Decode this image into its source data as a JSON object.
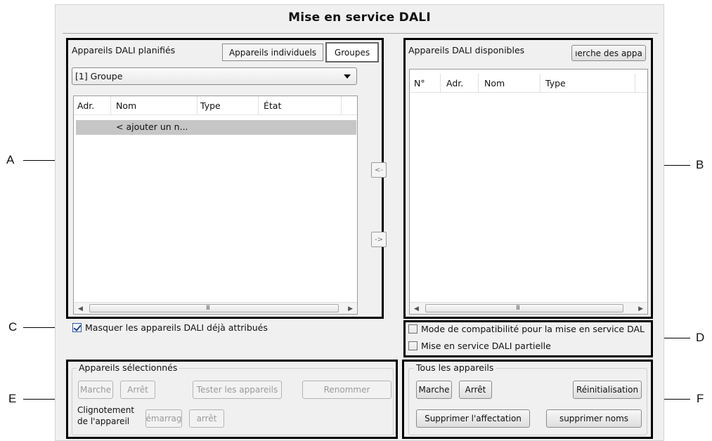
{
  "dialog": {
    "title": "Mise en service DALI"
  },
  "callouts": {
    "a": "A",
    "b": "B",
    "c": "C",
    "d": "D",
    "e": "E",
    "f": "F"
  },
  "planned": {
    "label": "Appareils DALI planifiés",
    "tab_individual": "Appareils individuels",
    "tab_groups": "Groupes",
    "dropdown_value": "[1] Groupe",
    "columns": [
      "Adr.",
      "Nom",
      "Type",
      "État"
    ],
    "add_row": "< ajouter un n...",
    "scroll_grip": "III"
  },
  "transfer": {
    "left": "<-",
    "right": "->"
  },
  "available": {
    "label": "Appareils DALI disponibles",
    "search_button": "ıerche des appa",
    "columns": [
      "N°",
      "Adr.",
      "Nom",
      "Type"
    ],
    "scroll_grip": "III"
  },
  "options": {
    "hide_assigned": {
      "label": "Masquer les appareils DALI déjà attribués",
      "checked": true
    },
    "compat_mode": {
      "label": "Mode de compatibilité pour la mise en service DAL",
      "checked": false
    },
    "partial": {
      "label": "Mise en service DALI partielle",
      "checked": false
    }
  },
  "selected_devices": {
    "group_title": "Appareils sélectionnés",
    "on": "Marche",
    "off": "Arrêt",
    "test": "Tester les appareils",
    "rename": "Renommer",
    "blink_label_1": "Clignotement",
    "blink_label_2": "de l'appareil",
    "blink_start": "émarrag",
    "blink_stop": "arrêt"
  },
  "all_devices": {
    "group_title": "Tous les appareils",
    "on": "Marche",
    "off": "Arrêt",
    "reset": "Réinitialisation",
    "delete_assignment": "Supprimer l'affectation",
    "delete_names": "supprimer noms"
  }
}
